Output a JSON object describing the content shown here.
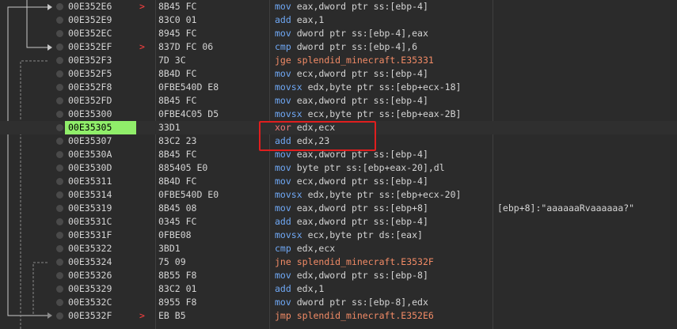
{
  "current_address": "00E35305",
  "rows": [
    {
      "addr": "00E352E6",
      "mark": ">",
      "bytes": "8B45 FC",
      "mn": "mov",
      "ops": "eax,dword ptr ss:[ebp-4]",
      "kind": "m",
      "cmt": ""
    },
    {
      "addr": "00E352E9",
      "mark": "",
      "bytes": "83C0 01",
      "mn": "add",
      "ops": "eax,1",
      "kind": "m",
      "cmt": ""
    },
    {
      "addr": "00E352EC",
      "mark": "",
      "bytes": "8945 FC",
      "mn": "mov",
      "ops": "dword ptr ss:[ebp-4],eax",
      "kind": "m",
      "cmt": ""
    },
    {
      "addr": "00E352EF",
      "mark": ">",
      "bytes": "837D FC 06",
      "mn": "cmp",
      "ops": "dword ptr ss:[ebp-4],6",
      "kind": "m",
      "cmt": ""
    },
    {
      "addr": "00E352F3",
      "mark": "",
      "bytes": "7D 3C",
      "mn": "jge",
      "ops": "splendid_minecraft.E35331",
      "kind": "mj",
      "cmt": ""
    },
    {
      "addr": "00E352F5",
      "mark": "",
      "bytes": "8B4D FC",
      "mn": "mov",
      "ops": "ecx,dword ptr ss:[ebp-4]",
      "kind": "m",
      "cmt": ""
    },
    {
      "addr": "00E352F8",
      "mark": "",
      "bytes": "0FBE540D E8",
      "mn": "movsx",
      "ops": "edx,byte ptr ss:[ebp+ecx-18]",
      "kind": "m",
      "cmt": ""
    },
    {
      "addr": "00E352FD",
      "mark": "",
      "bytes": "8B45 FC",
      "mn": "mov",
      "ops": "eax,dword ptr ss:[ebp-4]",
      "kind": "m",
      "cmt": ""
    },
    {
      "addr": "00E35300",
      "mark": "",
      "bytes": "0FBE4C05 D5",
      "mn": "movsx",
      "ops": "ecx,byte ptr ss:[ebp+eax-2B]",
      "kind": "m",
      "cmt": ""
    },
    {
      "addr": "00E35305",
      "mark": "",
      "bytes": "33D1",
      "mn": "xor",
      "ops": "edx,ecx",
      "kind": "mx",
      "cmt": ""
    },
    {
      "addr": "00E35307",
      "mark": "",
      "bytes": "83C2 23",
      "mn": "add",
      "ops": "edx,23",
      "kind": "m",
      "cmt": ""
    },
    {
      "addr": "00E3530A",
      "mark": "",
      "bytes": "8B45 FC",
      "mn": "mov",
      "ops": "eax,dword ptr ss:[ebp-4]",
      "kind": "m",
      "cmt": ""
    },
    {
      "addr": "00E3530D",
      "mark": "",
      "bytes": "885405 E0",
      "mn": "mov",
      "ops": "byte ptr ss:[ebp+eax-20],dl",
      "kind": "m",
      "cmt": ""
    },
    {
      "addr": "00E35311",
      "mark": "",
      "bytes": "8B4D FC",
      "mn": "mov",
      "ops": "ecx,dword ptr ss:[ebp-4]",
      "kind": "m",
      "cmt": ""
    },
    {
      "addr": "00E35314",
      "mark": "",
      "bytes": "0FBE540D E0",
      "mn": "movsx",
      "ops": "edx,byte ptr ss:[ebp+ecx-20]",
      "kind": "m",
      "cmt": ""
    },
    {
      "addr": "00E35319",
      "mark": "",
      "bytes": "8B45 08",
      "mn": "mov",
      "ops": "eax,dword ptr ss:[ebp+8]",
      "kind": "m",
      "cmt": "[ebp+8]:\"aaaaaaRvaaaaaa?\""
    },
    {
      "addr": "00E3531C",
      "mark": "",
      "bytes": "0345 FC",
      "mn": "add",
      "ops": "eax,dword ptr ss:[ebp-4]",
      "kind": "m",
      "cmt": ""
    },
    {
      "addr": "00E3531F",
      "mark": "",
      "bytes": "0FBE08",
      "mn": "movsx",
      "ops": "ecx,byte ptr ds:[eax]",
      "kind": "m",
      "cmt": ""
    },
    {
      "addr": "00E35322",
      "mark": "",
      "bytes": "3BD1",
      "mn": "cmp",
      "ops": "edx,ecx",
      "kind": "m",
      "cmt": ""
    },
    {
      "addr": "00E35324",
      "mark": "",
      "bytes": "75 09",
      "mn": "jne",
      "ops": "splendid_minecraft.E3532F",
      "kind": "mj",
      "cmt": ""
    },
    {
      "addr": "00E35326",
      "mark": "",
      "bytes": "8B55 F8",
      "mn": "mov",
      "ops": "edx,dword ptr ss:[ebp-8]",
      "kind": "m",
      "cmt": ""
    },
    {
      "addr": "00E35329",
      "mark": "",
      "bytes": "83C2 01",
      "mn": "add",
      "ops": "edx,1",
      "kind": "m",
      "cmt": ""
    },
    {
      "addr": "00E3532C",
      "mark": "",
      "bytes": "8955 F8",
      "mn": "mov",
      "ops": "dword ptr ss:[ebp-8],edx",
      "kind": "m",
      "cmt": ""
    },
    {
      "addr": "00E3532F",
      "mark": ">",
      "bytes": "EB B5",
      "mn": "jmp",
      "ops": "splendid_minecraft.E352E6",
      "kind": "mj",
      "cmt": ""
    }
  ],
  "colors": {
    "current_address_bg": "#90ee6a",
    "mnemonic": "#6fa8f5",
    "jump": "#f28b66",
    "xor": "#f07a7a",
    "highlight_box": "#e01e1e"
  }
}
